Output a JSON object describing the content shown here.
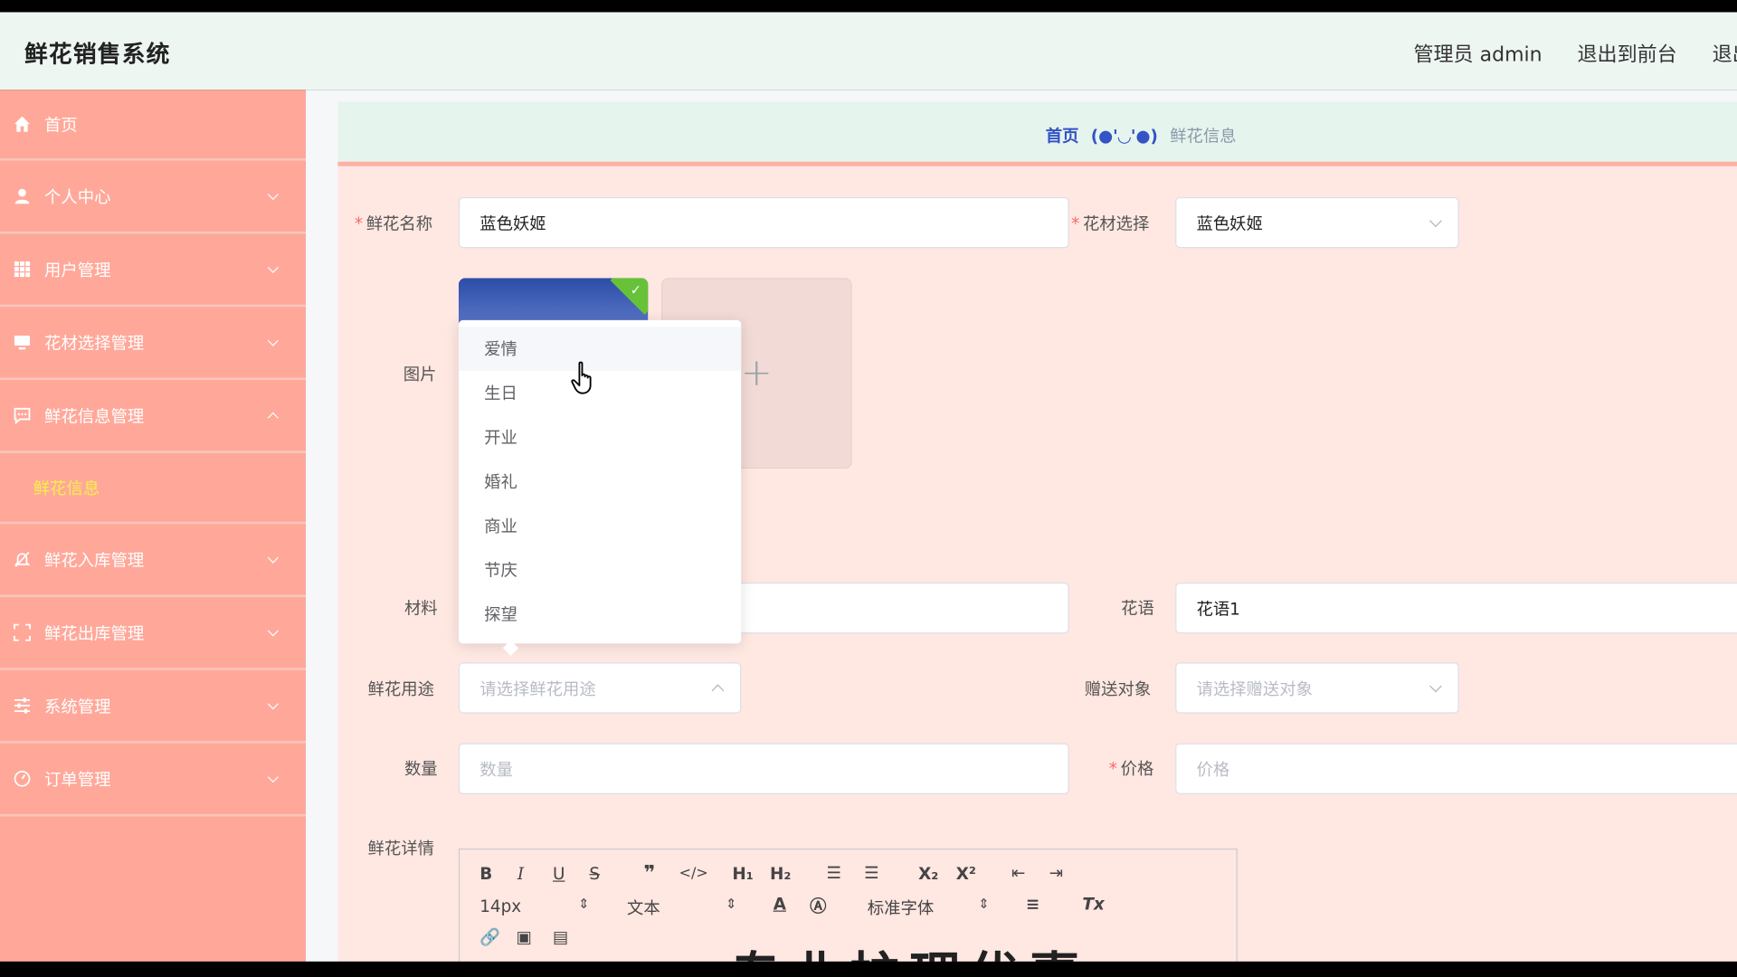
{
  "header": {
    "app_title": "鲜花销售系统",
    "admin_label": "管理员 admin",
    "exit_front": "退出到前台",
    "logout": "退出"
  },
  "sidebar": {
    "items": [
      {
        "label": "首页",
        "icon": "home-icon"
      },
      {
        "label": "个人中心",
        "icon": "user-icon"
      },
      {
        "label": "用户管理",
        "icon": "grid-icon"
      },
      {
        "label": "花材选择管理",
        "icon": "monitor-icon"
      },
      {
        "label": "鲜花信息管理",
        "icon": "chat-icon",
        "expanded": true
      },
      {
        "label": "鲜花入库管理",
        "icon": "bell-off-icon"
      },
      {
        "label": "鲜花出库管理",
        "icon": "fullscreen-icon"
      },
      {
        "label": "系统管理",
        "icon": "sliders-icon"
      },
      {
        "label": "订单管理",
        "icon": "gauge-icon"
      }
    ],
    "subitem": "鲜花信息"
  },
  "breadcrumb": {
    "home": "首页",
    "separator": "(●'◡'●)",
    "current": "鲜花信息"
  },
  "form": {
    "flower_name_label": "鲜花名称",
    "flower_name_value": "蓝色妖姬",
    "material_select_label": "花材选择",
    "material_select_value": "蓝色妖姬",
    "image_label": "图片",
    "material_label": "材料",
    "flower_language_label": "花语",
    "flower_language_value": "花语1",
    "usage_label": "鲜花用途",
    "usage_placeholder": "请选择鲜花用途",
    "recipient_label": "赠送对象",
    "recipient_placeholder": "请选择赠送对象",
    "quantity_label": "数量",
    "quantity_placeholder": "数量",
    "price_label": "价格",
    "price_placeholder": "价格",
    "detail_label": "鲜花详情"
  },
  "usage_options": [
    "爱情",
    "生日",
    "开业",
    "婚礼",
    "商业",
    "节庆",
    "探望"
  ],
  "editor": {
    "font_size": "14px",
    "text_style": "文本",
    "font_family": "标准字体",
    "content_preview": "专业护理优惠"
  },
  "colors": {
    "sidebar_bg": "#ffa89a",
    "panel_bg": "#ffe7e2",
    "header_bg": "#eef6f2",
    "breadcrumb_blue": "#3453c4",
    "active_submenu": "#f7f04a"
  }
}
